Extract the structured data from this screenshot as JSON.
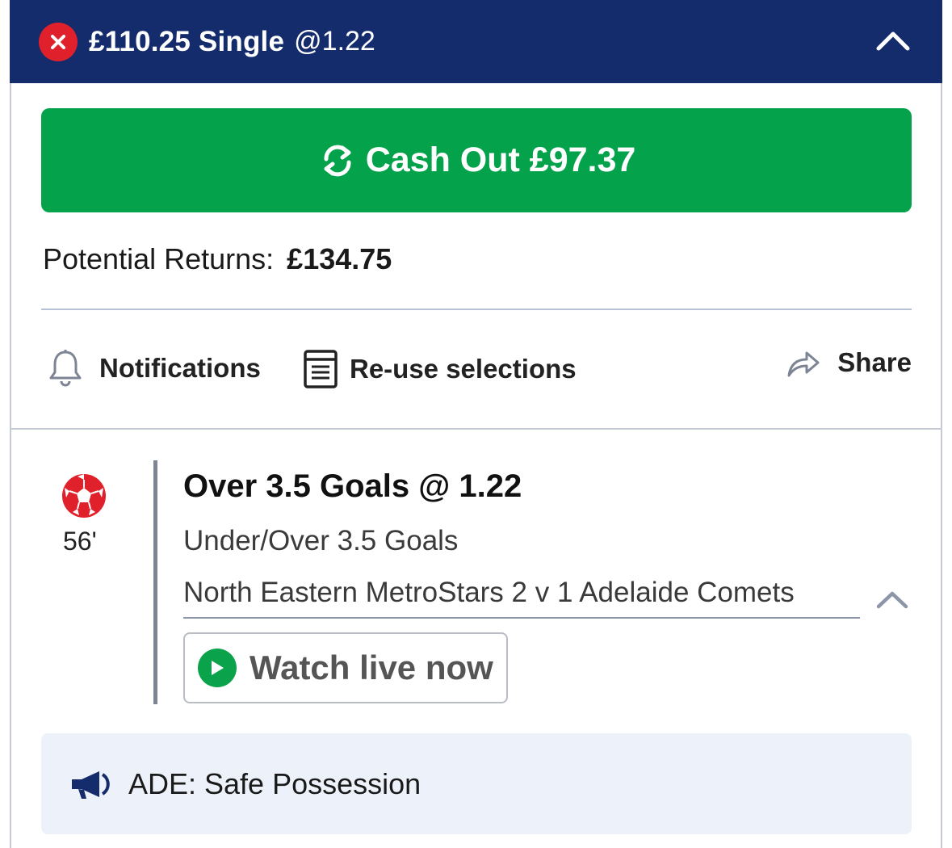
{
  "header": {
    "stake": "£110.25 Single",
    "odds": "@1.22",
    "status_icon": "close-icon",
    "status_color": "#e0202a",
    "background_color": "#142c6c"
  },
  "cashout": {
    "label": "Cash Out £97.37",
    "icon": "cashout-refresh-icon",
    "color": "#04a24a"
  },
  "returns": {
    "label": "Potential Returns:",
    "value": "£134.75"
  },
  "actions": {
    "notifications": "Notifications",
    "reuse": "Re-use selections",
    "share": "Share"
  },
  "selection": {
    "minute": "56'",
    "title": "Over 3.5 Goals @ 1.22",
    "market": "Under/Over 3.5 Goals",
    "event": "North Eastern MetroStars 2 v 1 Adelaide Comets",
    "watch_label": "Watch live now",
    "sport_icon": "football-icon"
  },
  "info": {
    "text": "ADE: Safe Possession",
    "icon": "megaphone-icon"
  }
}
